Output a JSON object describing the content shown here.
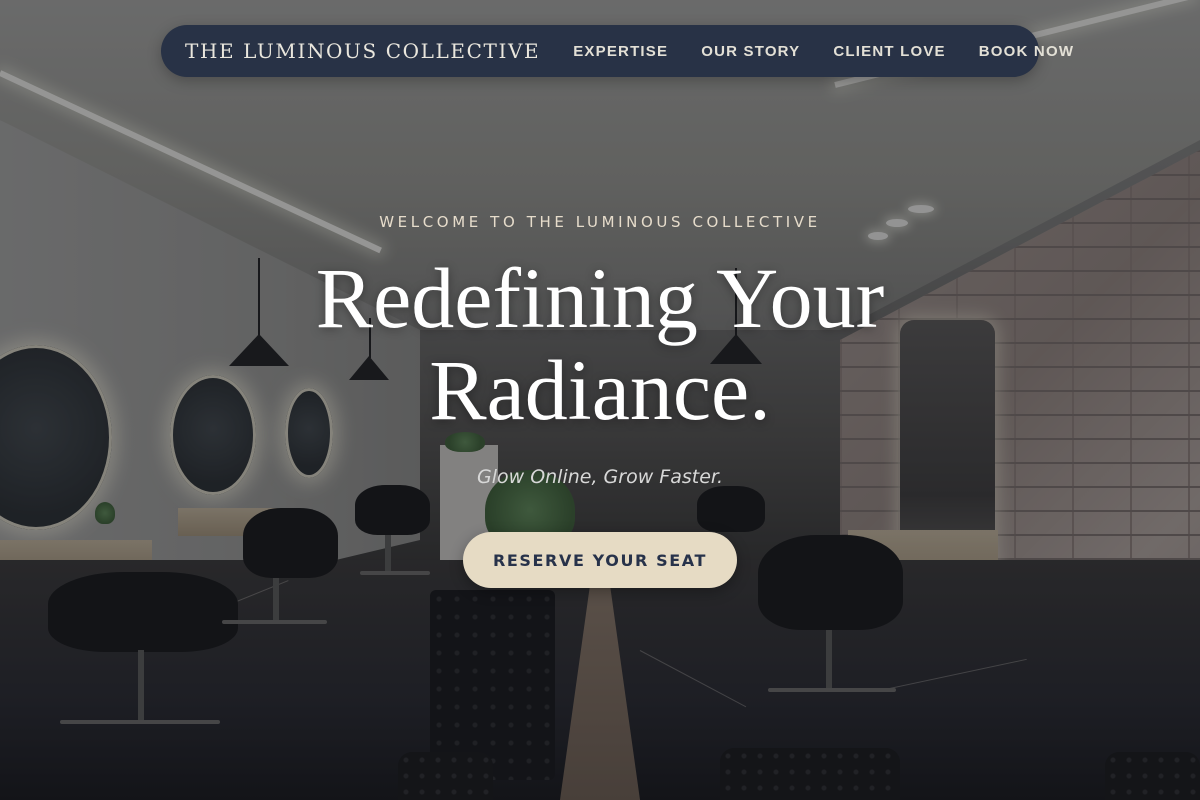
{
  "nav": {
    "brand": "THE LUMINOUS COLLECTIVE",
    "links": [
      {
        "label": "EXPERTISE"
      },
      {
        "label": "OUR STORY"
      },
      {
        "label": "CLIENT LOVE"
      },
      {
        "label": "BOOK NOW"
      }
    ]
  },
  "hero": {
    "eyebrow": "WELCOME TO THE LUMINOUS COLLECTIVE",
    "headline_line1": "Redefining Your",
    "headline_line2": "Radiance.",
    "tagline": "Glow Online, Grow Faster.",
    "cta_label": "RESERVE YOUR SEAT"
  },
  "colors": {
    "nav_background": "#283246",
    "cta_background": "#e6dbc4",
    "cta_text": "#27324a",
    "eyebrow_text": "#e6dccb"
  }
}
